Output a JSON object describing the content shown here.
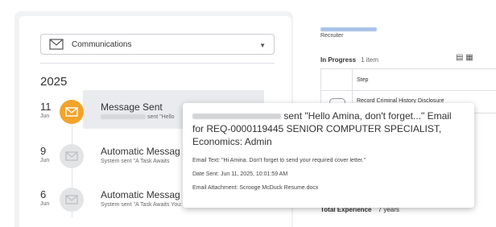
{
  "timeline": {
    "filter": {
      "selected": "Communications",
      "icon": "envelope-icon"
    },
    "year": "2025",
    "events": [
      {
        "day": "11",
        "month": "Jun",
        "title": "Message Sent",
        "subtitle_tail": "sent \"Hello",
        "state": "active"
      },
      {
        "day": "9",
        "month": "Jun",
        "title": "Automatic Messag",
        "subtitle": "System sent \"A Task Awaits",
        "state": "inactive"
      },
      {
        "day": "6",
        "month": "Jun",
        "title": "Automatic Messag",
        "subtitle": "System sent \"A Task Awaits You: Complete...",
        "state": "inactive"
      }
    ]
  },
  "recruiter_panel": {
    "role": "Recruiter",
    "in_progress_label": "In Progress",
    "in_progress_count": "1 item",
    "table": {
      "column_step": "Step",
      "row_step": "Record Criminal History Disclosure"
    },
    "total_experience_label": "Total Experience",
    "total_experience_value": "7 years"
  },
  "tooltip": {
    "headline": "sent \"Hello Amina, don't forget...\" Email for REQ-0000119445 SENIOR COMPUTER SPECIALIST, Economics: Admin",
    "email_text": "Email Text: \"Hi Amina. Don't forget to send your required cover letter.\"",
    "date_sent": "Date Sent: Jun 11, 2025, 10:01:59 AM",
    "attachment": "Email Attachment: Scrooge McDuck Resume.docx"
  },
  "colors": {
    "accent_active": "#f1a42b",
    "inactive_icon": "#e3e4e6"
  }
}
